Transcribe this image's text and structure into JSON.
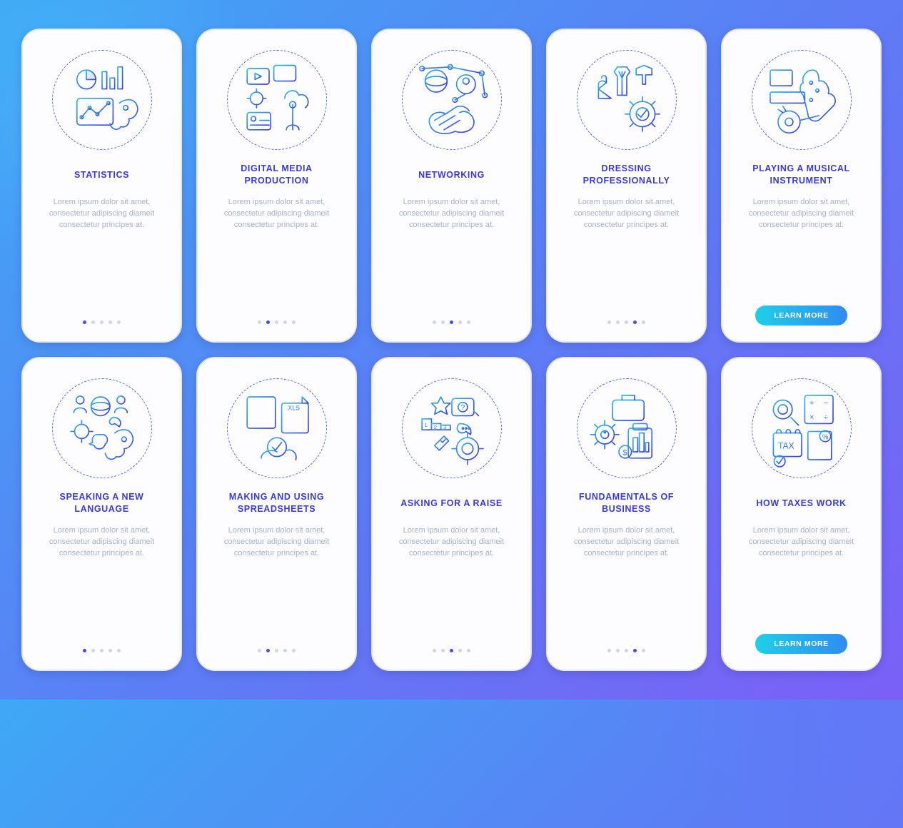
{
  "common": {
    "desc": "Lorem ipsum dolor sit amet, consectetur adipiscing diameit consectetur principes at.",
    "cta_label": "LEARN MORE"
  },
  "screens": [
    {
      "title": "STATISTICS",
      "activeDot": 0,
      "icon": "statistics",
      "cta": false
    },
    {
      "title": "DIGITAL MEDIA PRODUCTION",
      "activeDot": 1,
      "icon": "digital-media",
      "cta": false
    },
    {
      "title": "NETWORKING",
      "activeDot": 2,
      "icon": "networking",
      "cta": false
    },
    {
      "title": "DRESSING PROFESSIONALLY",
      "activeDot": 3,
      "icon": "dressing",
      "cta": false
    },
    {
      "title": "PLAYING A MUSICAL INSTRUMENT",
      "activeDot": 4,
      "icon": "music",
      "cta": true
    },
    {
      "title": "SPEAKING A NEW LANGUAGE",
      "activeDot": 0,
      "icon": "language",
      "cta": false
    },
    {
      "title": "MAKING AND USING SPREADSHEETS",
      "activeDot": 1,
      "icon": "spreadsheets",
      "cta": false
    },
    {
      "title": "ASKING FOR A RAISE",
      "activeDot": 2,
      "icon": "raise",
      "cta": false
    },
    {
      "title": "FUNDAMENTALS OF BUSINESS",
      "activeDot": 3,
      "icon": "business",
      "cta": false
    },
    {
      "title": "HOW TAXES WORK",
      "activeDot": 4,
      "icon": "taxes",
      "cta": true
    }
  ]
}
